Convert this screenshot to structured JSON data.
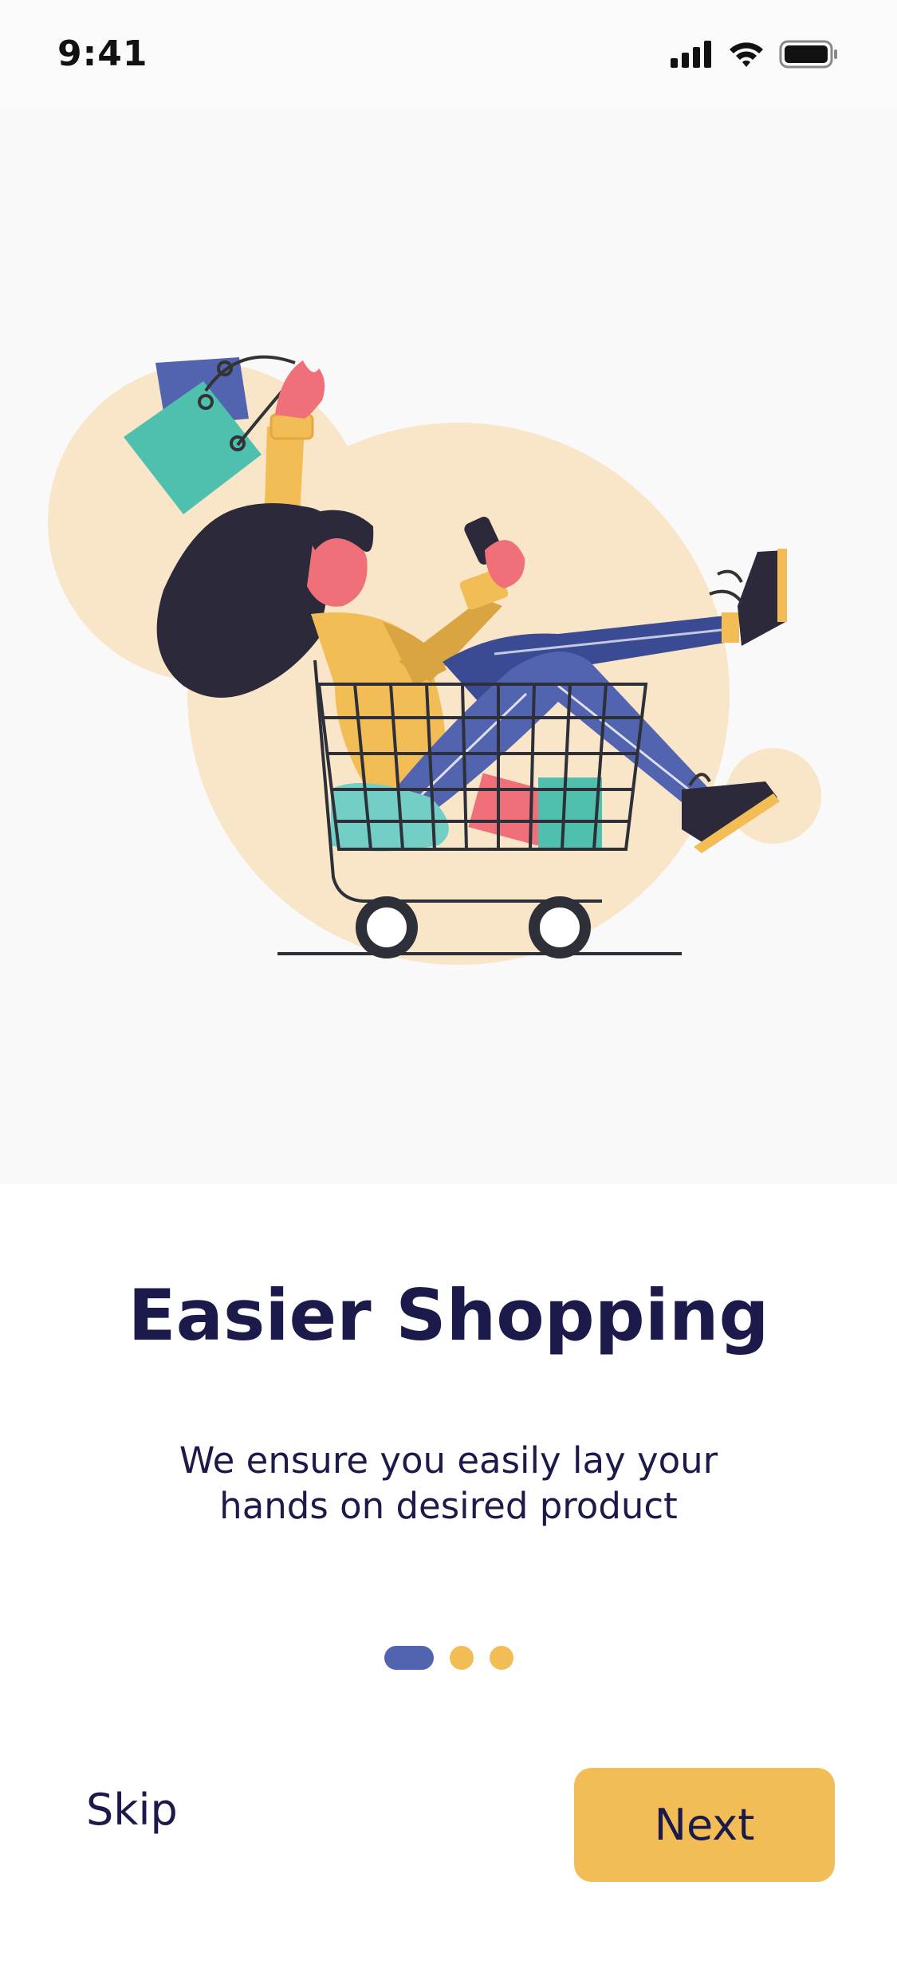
{
  "status_bar": {
    "time": "9:41",
    "icons": [
      "signal-icon",
      "wifi-icon",
      "battery-icon"
    ]
  },
  "illustration": {
    "name": "shopping-cart-illustration"
  },
  "onboarding": {
    "title": "Easier Shopping",
    "subtitle": "We ensure you easily lay your hands on desired product",
    "pages_total": 3,
    "page_current": 1
  },
  "actions": {
    "skip_label": "Skip",
    "next_label": "Next"
  },
  "colors": {
    "accent_yellow": "#f2bd55",
    "primary_blue": "#5263b0",
    "text_dark": "#1c1a4a",
    "blob_peach": "#f9e5c8"
  }
}
